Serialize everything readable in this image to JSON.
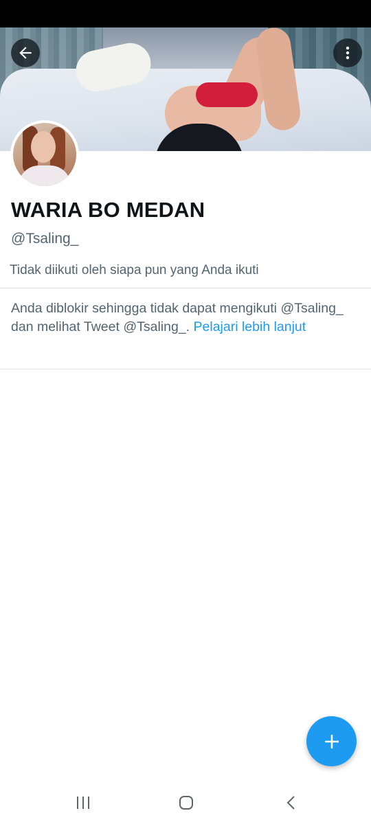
{
  "profile": {
    "display_name": "WARIA BO MEDAN",
    "handle": "@Tsaling_",
    "follow_note": "Tidak diikuti oleh siapa pun yang Anda ikuti"
  },
  "blocked_notice": {
    "text_before": "Anda diblokir sehingga tidak dapat mengikuti",
    "handle_1": "@Tsaling_",
    "text_middle": "dan melihat Tweet",
    "handle_2": "@Tsaling_.",
    "link_text": "Pelajari lebih lanjut"
  },
  "icons": {
    "back": "arrow-left-icon",
    "more": "more-vertical-icon",
    "compose": "plus-icon",
    "recents": "recent-apps-icon",
    "home": "home-icon",
    "nav_back": "chevron-left-icon"
  },
  "colors": {
    "accent": "#1d9bf0",
    "text_primary": "#0f1419",
    "text_secondary": "#536471",
    "divider": "#e1e5e8"
  }
}
